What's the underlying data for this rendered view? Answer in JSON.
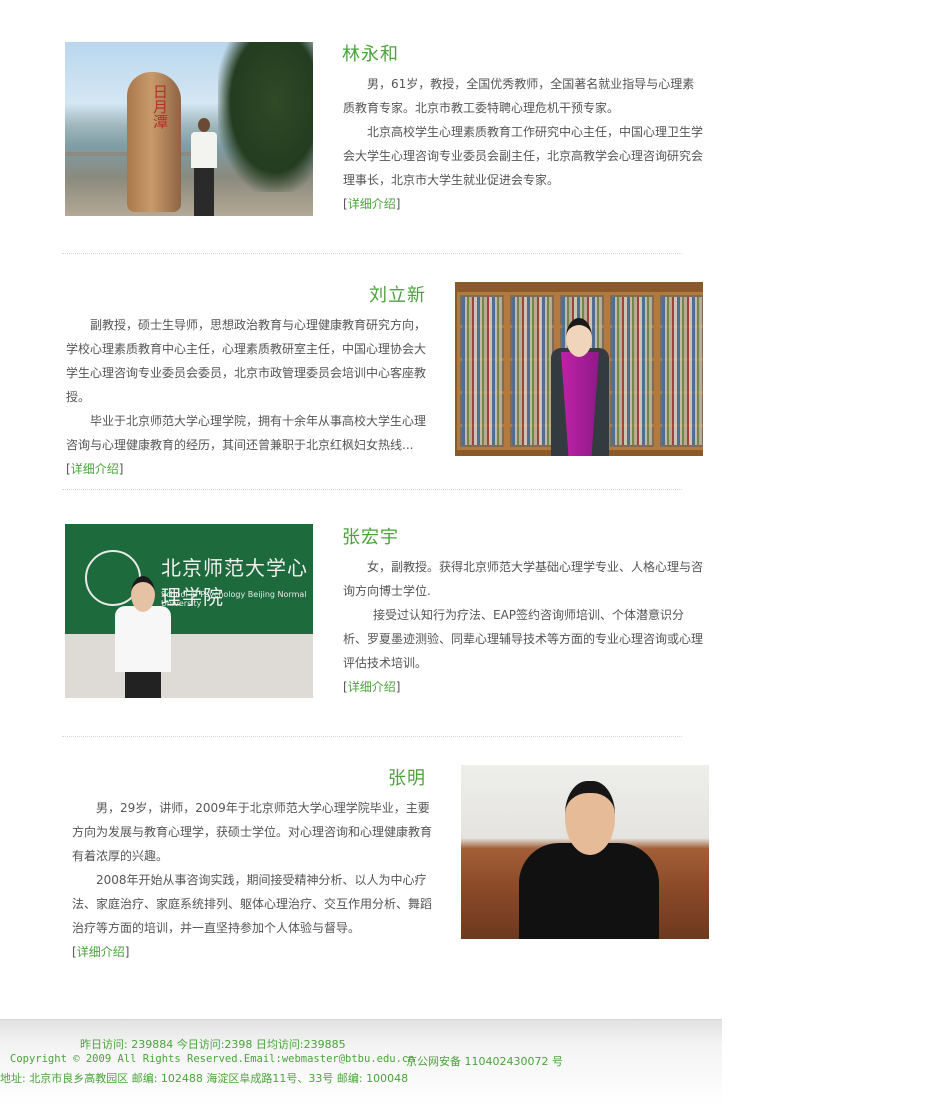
{
  "profiles": [
    {
      "name": "林永和",
      "paragraphs": [
        "男，61岁，教授，全国优秀教师，全国著名就业指导与心理素质教育专家。北京市教工委特聘心理危机干预专家。",
        "北京高校学生心理素质教育工作研究中心主任，中国心理卫生学会大学生心理咨询专业委员会副主任，北京高教学会心理咨询研究会理事长，北京市大学生就业促进会专家。"
      ],
      "photo_text": "日月潭"
    },
    {
      "name": "刘立新",
      "paragraphs": [
        "副教授，硕士生导师，思想政治教育与心理健康教育研究方向，学校心理素质教育中心主任，心理素质教研室主任，中国心理协会大学生心理咨询专业委员会委员，北京市政管理委员会培训中心客座教授。",
        "毕业于北京师范大学心理学院，拥有十余年从事高校大学生心理咨询与心理健康教育的经历，其间还曾兼职于北京红枫妇女热线..."
      ]
    },
    {
      "name": "张宏宇",
      "paragraphs": [
        "女，副教授。获得北京师范大学基础心理学专业、人格心理与咨询方向博士学位.",
        "接受过认知行为疗法、EAP签约咨询师培训、个体潜意识分析、罗夏墨迹测验、同辈心理辅导技术等方面的专业心理咨询或心理评估技术培训。"
      ],
      "photo_text": {
        "sign_cn": "北京师范大学心理学院",
        "sign_en": "School of Psychology Beijing Normal University"
      }
    },
    {
      "name": "张明",
      "paragraphs": [
        "男，29岁，讲师，2009年于北京师范大学心理学院毕业，主要方向为发展与教育心理学，获硕士学位。对心理咨询和心理健康教育有着浓厚的兴趣。",
        "2008年开始从事咨询实践，期间接受精神分析、以人为中心疗法、家庭治疗、家庭系统排列、躯体心理治疗、交互作用分析、舞蹈治疗等方面的培训，并一直坚持参加个人体验与督导。"
      ]
    }
  ],
  "more_link": {
    "open": "[",
    "label": "详细介绍",
    "close": "]"
  },
  "footer": {
    "stats": "昨日访问: 239884   今日访问:2398  日均访问:239885",
    "copyright": "Copyright © 2009 All Rights Reserved.Email:webmaster@btbu.edu.cn",
    "icp": "京公网安备 110402430072 号",
    "address": "地址: 北京市良乡高教园区 邮编: 102488    海淀区阜成路11号、33号 邮编: 100048"
  },
  "colors": {
    "accent_green": "#4aa43a",
    "body_text": "#555555"
  }
}
